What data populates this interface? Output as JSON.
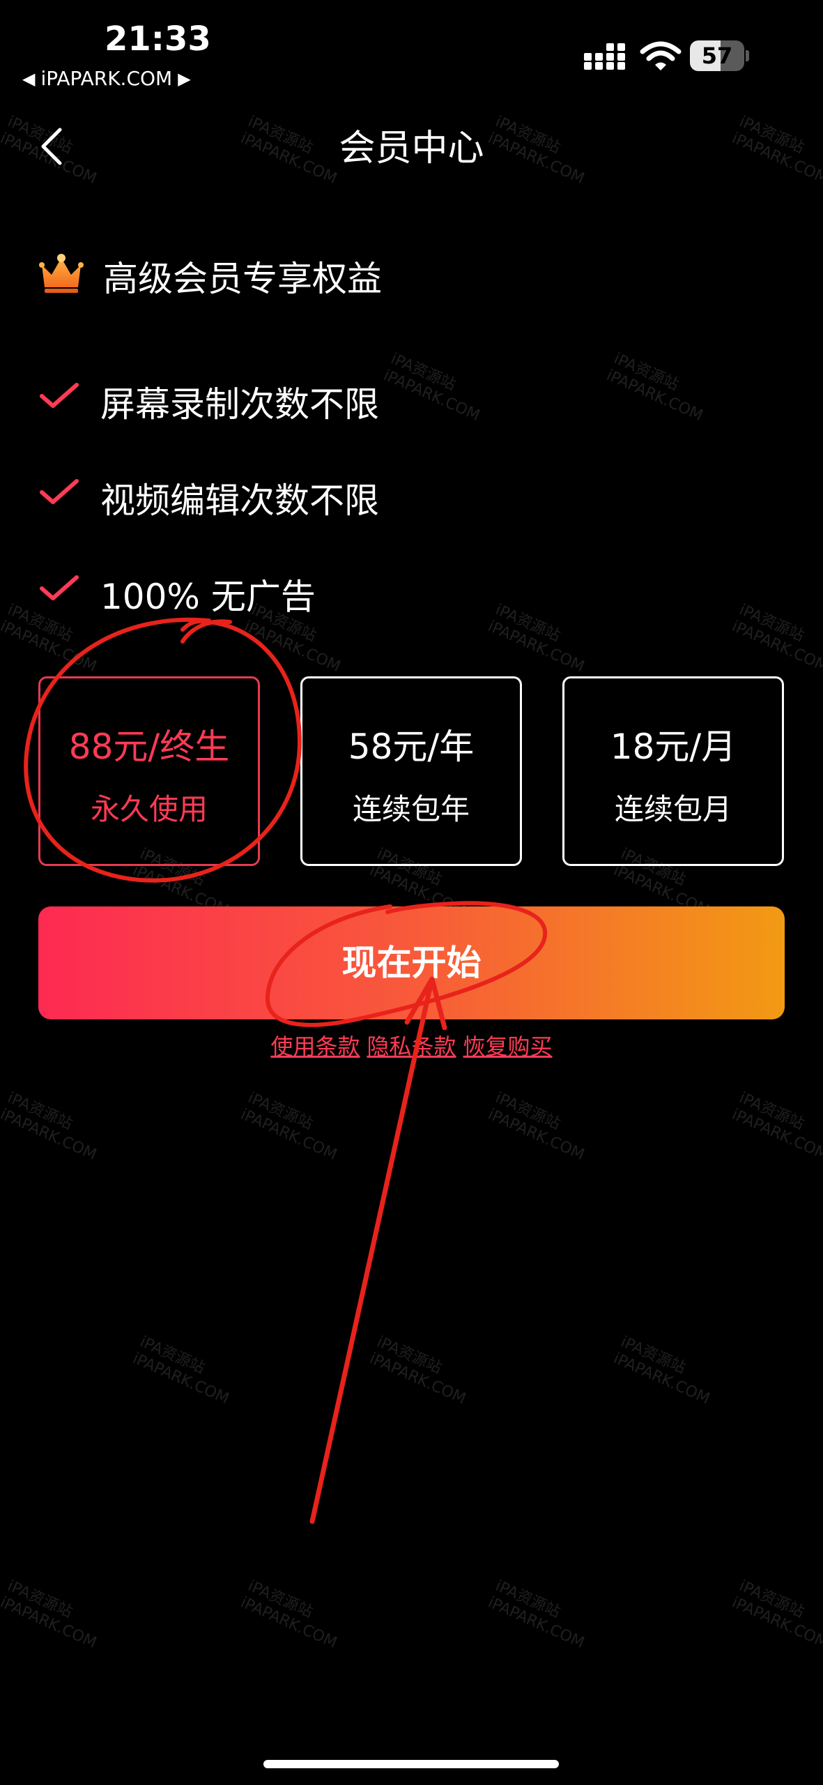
{
  "status_bar": {
    "time": "21:33",
    "back_app_label": "iPAPARK.COM",
    "battery_level": "57"
  },
  "header": {
    "title": "会员中心"
  },
  "benefits": {
    "heading": "高级会员专享权益",
    "items": [
      "屏幕录制次数不限",
      "视频编辑次数不限",
      "100% 无广告"
    ]
  },
  "plans": [
    {
      "price": "88元/终生",
      "desc": "永久使用",
      "selected": true
    },
    {
      "price": "58元/年",
      "desc": "连续包年",
      "selected": false
    },
    {
      "price": "18元/月",
      "desc": "连续包月",
      "selected": false
    }
  ],
  "cta": {
    "label": "现在开始"
  },
  "links": {
    "terms": "使用条款",
    "privacy": "隐私条款",
    "restore": "恢复购买"
  },
  "watermark": {
    "line1": "iPA资源站",
    "line2": "iPAPARK.COM"
  },
  "colors": {
    "accent_red": "#ff3b55",
    "gradient_start": "#fd2a52",
    "gradient_end": "#f29a14",
    "background": "#000000"
  }
}
